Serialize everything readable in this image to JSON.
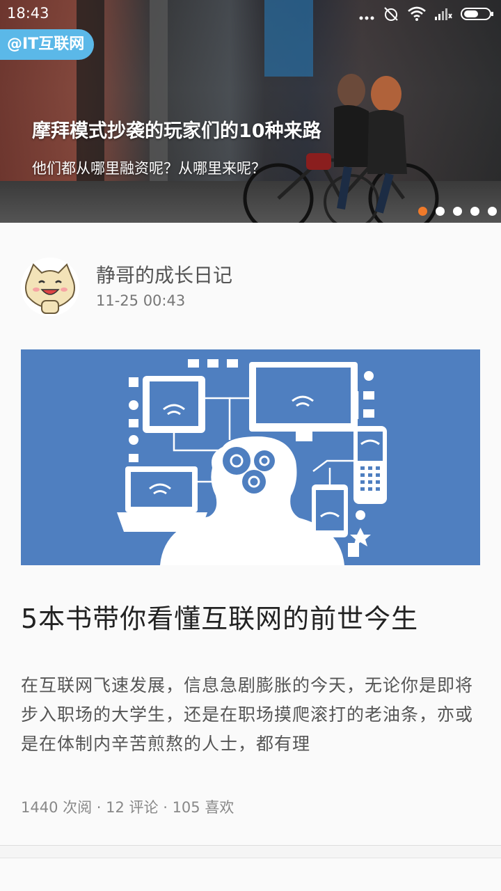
{
  "status": {
    "time": "18:43"
  },
  "banner": {
    "tag": "@IT互联网",
    "title": "摩拜模式抄袭的玩家们的10种来路",
    "subtitle": "他们都从哪里融资呢？从哪里来呢？",
    "pager": {
      "count": 5,
      "active_index": 0
    },
    "colors": {
      "tag_bg": "#5bb8e8",
      "active_dot": "#f07a2a"
    }
  },
  "post": {
    "author": "静哥的成长日记",
    "date": "11-25 00:43",
    "title": "5本书带你看懂互联网的前世今生",
    "excerpt": "在互联网飞速发展，信息急剧膨胀的今天，无论你是即将步入职场的大学生，还是在职场摸爬滚打的老油条，亦或是在体制内辛苦煎熬的人士，都有理",
    "meta": "1440 次阅 · 12 评论 · 105 喜欢",
    "hero_color": "#4f7fc0"
  }
}
